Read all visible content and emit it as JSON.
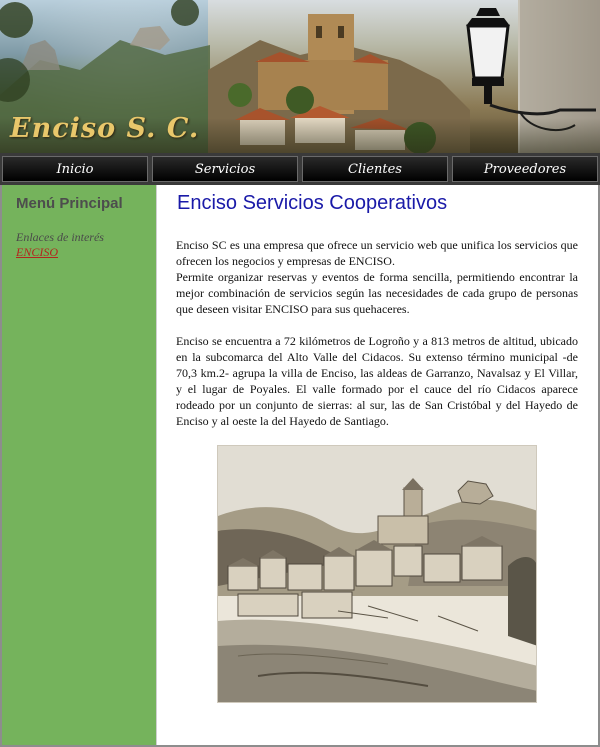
{
  "header": {
    "logo_text": "Enciso S. C."
  },
  "nav": {
    "items": [
      {
        "label": "Inicio"
      },
      {
        "label": "Servicios"
      },
      {
        "label": "Clientes"
      },
      {
        "label": "Proveedores"
      }
    ]
  },
  "sidebar": {
    "title": "Menú Principal",
    "links_heading": "Enlaces de interés",
    "link": "ENCISO"
  },
  "main": {
    "title": "Enciso Servicios Cooperativos",
    "paragraph1": "Enciso SC es una empresa que ofrece un servicio web que unifica los servicios que ofrecen los negocios y empresas de ENCISO.",
    "paragraph2": "Permite organizar reservas y eventos de forma sencilla, permitiendo encontrar la mejor combinación de servicios según las necesidades de cada grupo de personas que deseen visitar ENCISO para sus quehaceres.",
    "paragraph3": "Enciso se encuentra a 72 kilómetros de Logroño y a 813 metros de altitud, ubicado en la subcomarca del Alto Valle del Cidacos. Su extenso término municipal -de 70,3 km.2- agrupa la villa de Enciso, las aldeas de Garranzo, Navalsaz y El Villar, y el lugar de Poyales. El valle formado por el cauce del río Cidacos aparece rodeado por un conjunto de sierras: al sur, las de San Cristóbal y del Hayedo de Enciso y al oeste la del Hayedo de Santiago."
  },
  "colors": {
    "sidebar_bg": "#75b35c",
    "title_blue": "#1a1aa8",
    "link_red": "#b3261e",
    "logo_gold": "#e9c76b",
    "nav_bg": "#000000"
  },
  "icons": {
    "lamp": "street-lamp-icon"
  }
}
